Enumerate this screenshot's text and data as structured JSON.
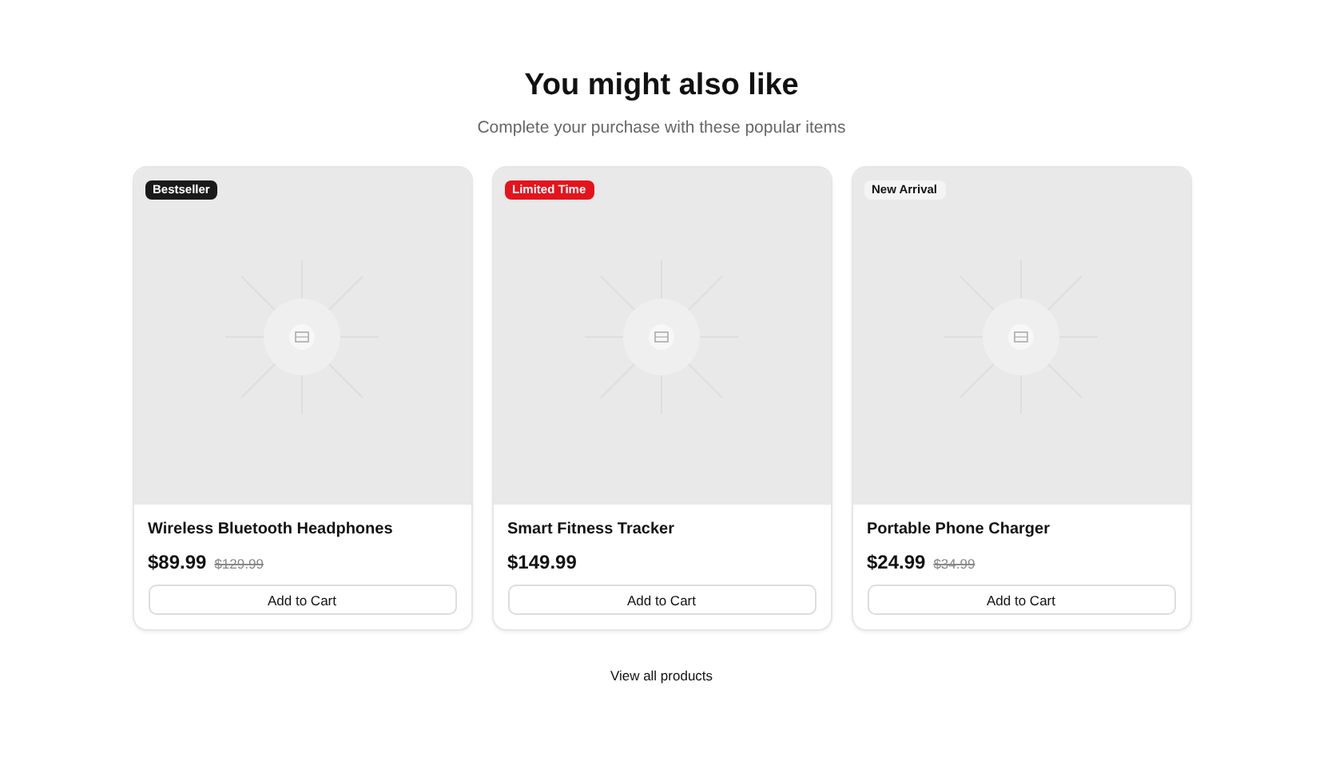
{
  "heading": "You might also like",
  "subheading": "Complete your purchase with these popular items",
  "products": [
    {
      "badge": {
        "text": "Bestseller",
        "kind": "dark"
      },
      "name": "Wireless Bluetooth Headphones",
      "price": "$89.99",
      "old_price": "$129.99",
      "button": "Add to Cart"
    },
    {
      "badge": {
        "text": "Limited Time",
        "kind": "sale"
      },
      "name": "Smart Fitness Tracker",
      "price": "$149.99",
      "button": "Add to Cart"
    },
    {
      "badge": {
        "text": "New Arrival",
        "kind": "light"
      },
      "name": "Portable Phone Charger",
      "price": "$24.99",
      "old_price": "$34.99",
      "button": "Add to Cart"
    }
  ],
  "link": "View all products"
}
